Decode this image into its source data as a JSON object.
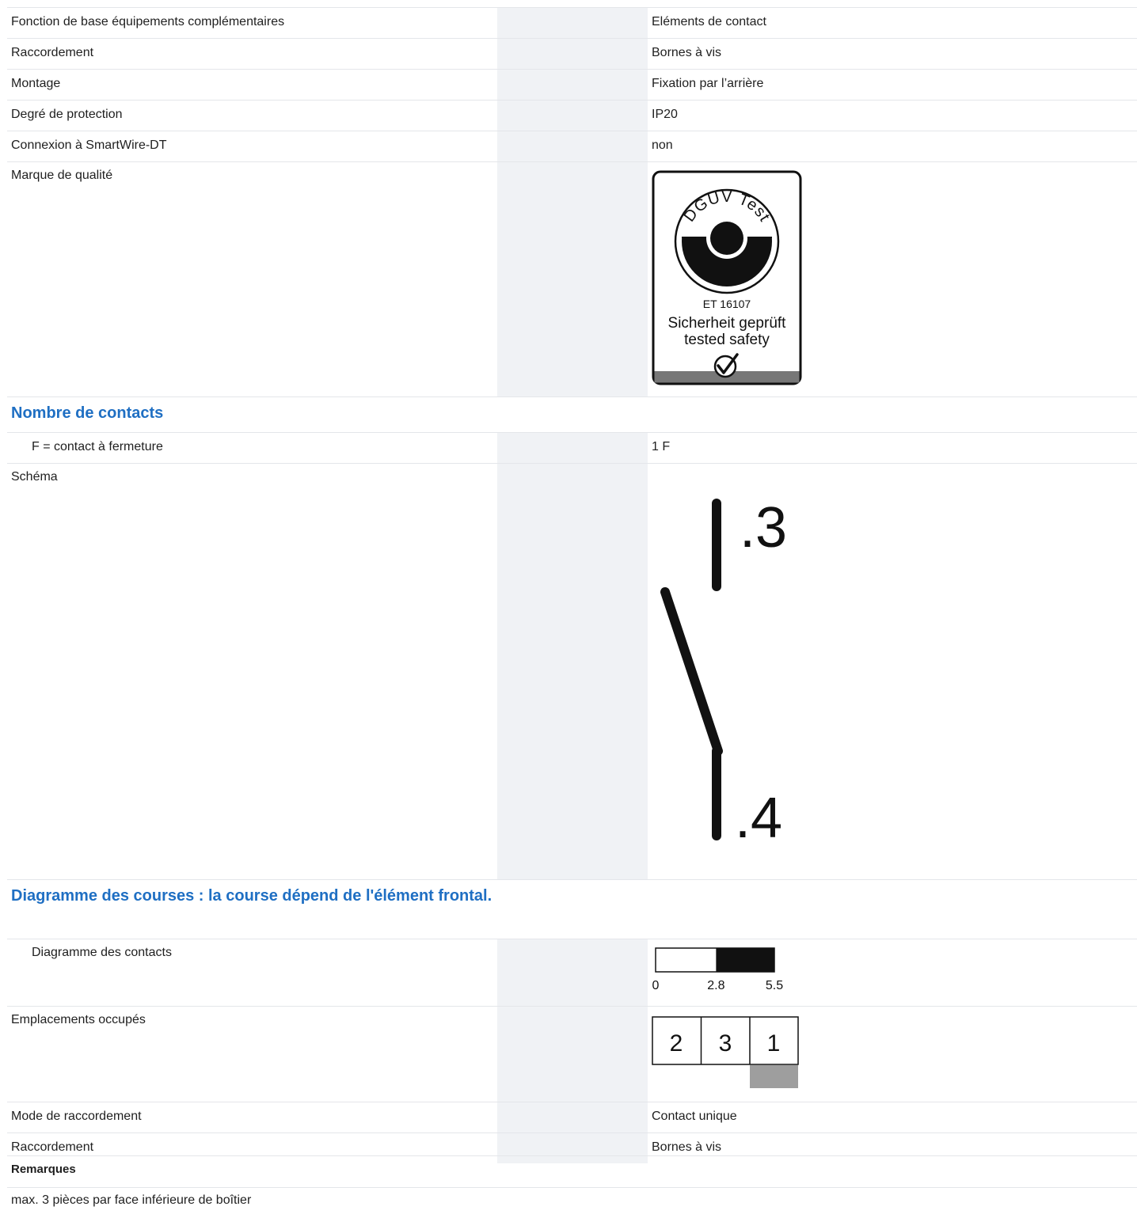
{
  "rows": {
    "fonction": {
      "label": "Fonction de base équipements complémentaires",
      "value": "Eléments de contact"
    },
    "raccordement1": {
      "label": "Raccordement",
      "value": "Bornes à vis"
    },
    "montage": {
      "label": "Montage",
      "value": "Fixation par l’arrière"
    },
    "protection": {
      "label": "Degré de protection",
      "value": "IP20"
    },
    "smartwire": {
      "label": "Connexion à SmartWire-DT",
      "value": "non"
    },
    "marque": {
      "label": "Marque de qualité"
    },
    "section_contacts": {
      "label": "Nombre de contacts"
    },
    "f_contact": {
      "label": "F = contact à fermeture",
      "value": "1 F"
    },
    "schema": {
      "label": "Schéma"
    },
    "section_courses": {
      "label": "Diagramme des courses : la course dépend de l'élément frontal."
    },
    "diagramme_contacts": {
      "label": "Diagramme des contacts"
    },
    "emplacements": {
      "label": "Emplacements occupés"
    },
    "mode": {
      "label": "Mode de raccordement",
      "value": "Contact unique"
    },
    "raccordement2": {
      "label": "Raccordement",
      "value": "Bornes à vis"
    }
  },
  "quality_mark": {
    "ring_text": "DGUV Test",
    "code": "ET 16107",
    "line1": "Sicherheit geprüft",
    "line2": "tested safety"
  },
  "schema": {
    "top_terminal": ".3",
    "bottom_terminal": ".4"
  },
  "contact_diagram": {
    "ticks": [
      "0",
      "2.8",
      "5.5"
    ],
    "closed_from": 2.8,
    "closed_to": 5.5,
    "max": 5.5
  },
  "slots": {
    "cells": [
      "2",
      "3",
      "1"
    ],
    "occupied_index": 2
  },
  "remarks": {
    "title": "Remarques",
    "text": "max. 3 pièces par face inférieure de boîtier"
  }
}
